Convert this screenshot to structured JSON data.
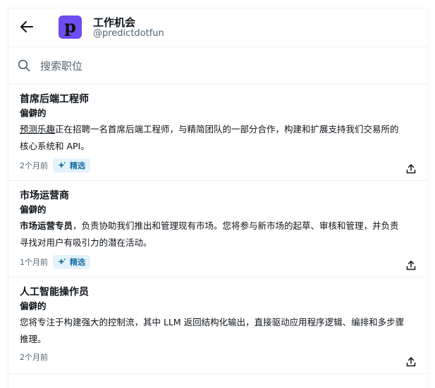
{
  "header": {
    "title": "工作机会",
    "handle": "@predictdotfun",
    "logo_letter": "p"
  },
  "search": {
    "placeholder": "搜索职位"
  },
  "jobs": [
    {
      "title": "首席后端工程师",
      "company": "偏僻的",
      "desc_lead": "预测乐趣",
      "desc_line1_rest": "正在招聘一名首席后端工程师，与精简团队的一部分合作，构建和扩展支持我们交易所的",
      "desc_line2": "核心系统和 API。",
      "time": "2个月前",
      "badge": "精选"
    },
    {
      "title": "市场运营商",
      "company": "偏僻的",
      "desc_lead": "市场运营专员",
      "desc_line1_rest": "，负责协助我们推出和管理现有市场。您将参与新市场的起草、审核和管理，并负责",
      "desc_line2": "寻找对用户有吸引力的潜在活动。",
      "time": "1个月前",
      "badge": "精选"
    },
    {
      "title": "人工智能操作员",
      "company": "偏僻的",
      "desc_line1": "您将专注于构建强大的控制流，其中 LLM 返回结构化输出，直接驱动应用程序逻辑、编排和多步骤",
      "desc_line2": "推理。",
      "time": "2个月前"
    }
  ],
  "colors": {
    "accent_badge_bg": "#e3f2fb",
    "accent_badge_text": "#1d6fa5",
    "logo_bg": "#6d4cf0"
  }
}
